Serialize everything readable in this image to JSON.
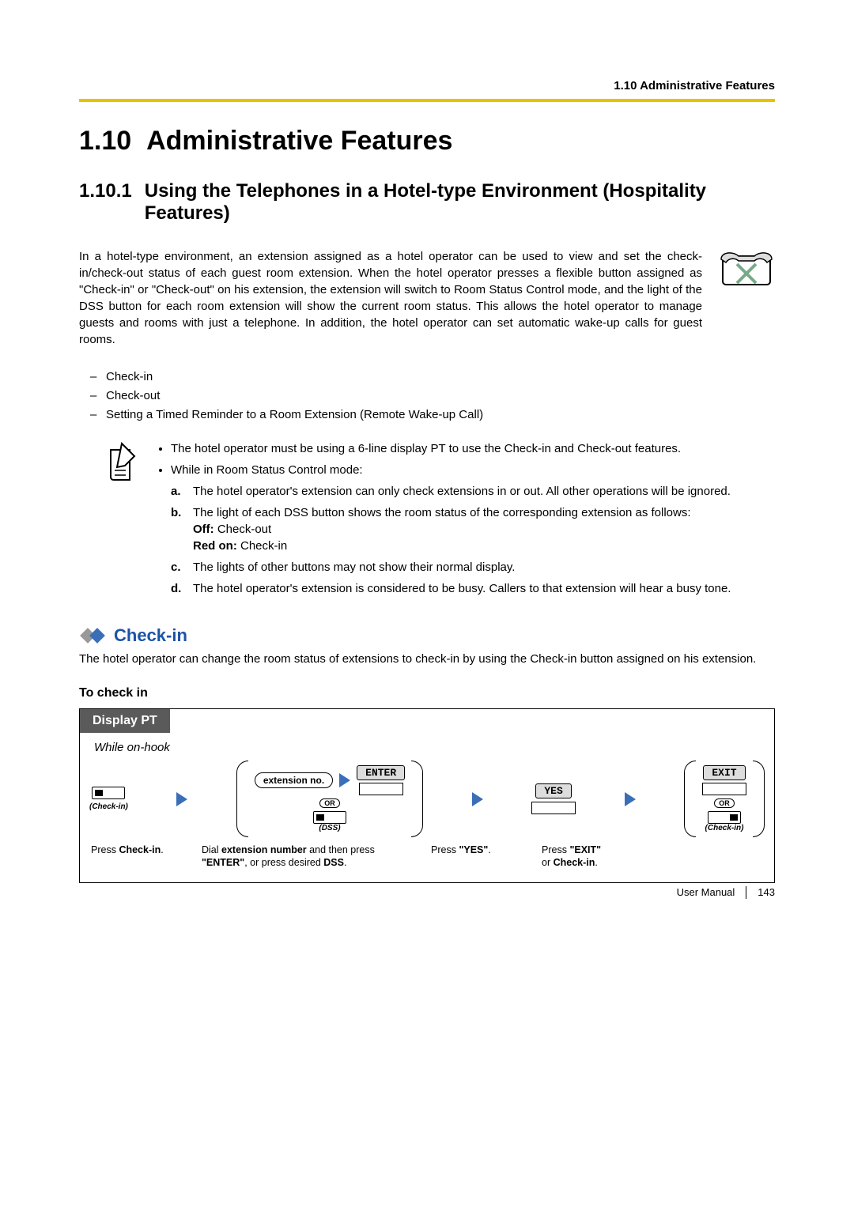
{
  "header": {
    "running": "1.10 Administrative Features"
  },
  "section": {
    "number": "1.10",
    "title": "Administrative Features"
  },
  "subsection": {
    "number": "1.10.1",
    "title": "Using the Telephones in a Hotel-type Environment (Hospitality Features)"
  },
  "intro": "In a hotel-type environment, an extension assigned as a hotel operator can be used to view and set the check-in/check-out status of each guest room extension. When the hotel operator presses a flexible button assigned as \"Check-in\" or \"Check-out\" on his extension, the extension will switch to Room Status Control mode, and the light of the DSS button for each room extension will show the current room status. This allows the hotel operator to manage guests and rooms with just a telephone. In addition, the hotel operator can set automatic wake-up calls for guest rooms.",
  "dash_items": [
    "Check-in",
    "Check-out",
    "Setting a Timed Reminder to a Room Extension (Remote Wake-up Call)"
  ],
  "notes": {
    "b1": "The hotel operator must be using a 6-line display PT to use the Check-in and Check-out features.",
    "b2": "While in Room Status Control mode:",
    "a": "The hotel operator's extension can only check extensions in or out. All other operations will be ignored.",
    "b_lead": "The light of each DSS button shows the room status of the corresponding extension as follows:",
    "b_off_label": "Off:",
    "b_off_value": "Check-out",
    "b_red_label": "Red on:",
    "b_red_value": "Check-in",
    "c": "The lights of other buttons may not show their normal display.",
    "d": "The hotel operator's extension is considered to be busy. Callers to that extension will hear a busy tone."
  },
  "feature": {
    "title": "Check-in",
    "desc": "The hotel operator can change the room status of extensions to check-in by using the Check-in button assigned on his extension."
  },
  "procedure": {
    "title": "To check in",
    "tab": "Display PT",
    "condition": "While on-hook",
    "step1_btn_label": "(Check-in)",
    "group1_pill": "extension no.",
    "group1_enter_tab": "ENTER",
    "group1_or": "OR",
    "group1_dss": "(DSS)",
    "yes_tab": "YES",
    "group2_exit_tab": "EXIT",
    "group2_or": "OR",
    "group2_btn_label": "(Check-in)",
    "cap1_a": "Press ",
    "cap1_b": "Check-in",
    "cap1_c": ".",
    "cap2_a": "Dial ",
    "cap2_b": "extension number",
    "cap2_c": " and then press ",
    "cap2_d": "\"ENTER\"",
    "cap2_e": ", or press desired ",
    "cap2_f": "DSS",
    "cap2_g": ".",
    "cap3_a": "Press ",
    "cap3_b": "\"YES\"",
    "cap3_c": ".",
    "cap4_a": "Press ",
    "cap4_b": "\"EXIT\"",
    "cap4_c": "or ",
    "cap4_d": "Check-in",
    "cap4_e": "."
  },
  "footer": {
    "manual": "User Manual",
    "page": "143"
  }
}
